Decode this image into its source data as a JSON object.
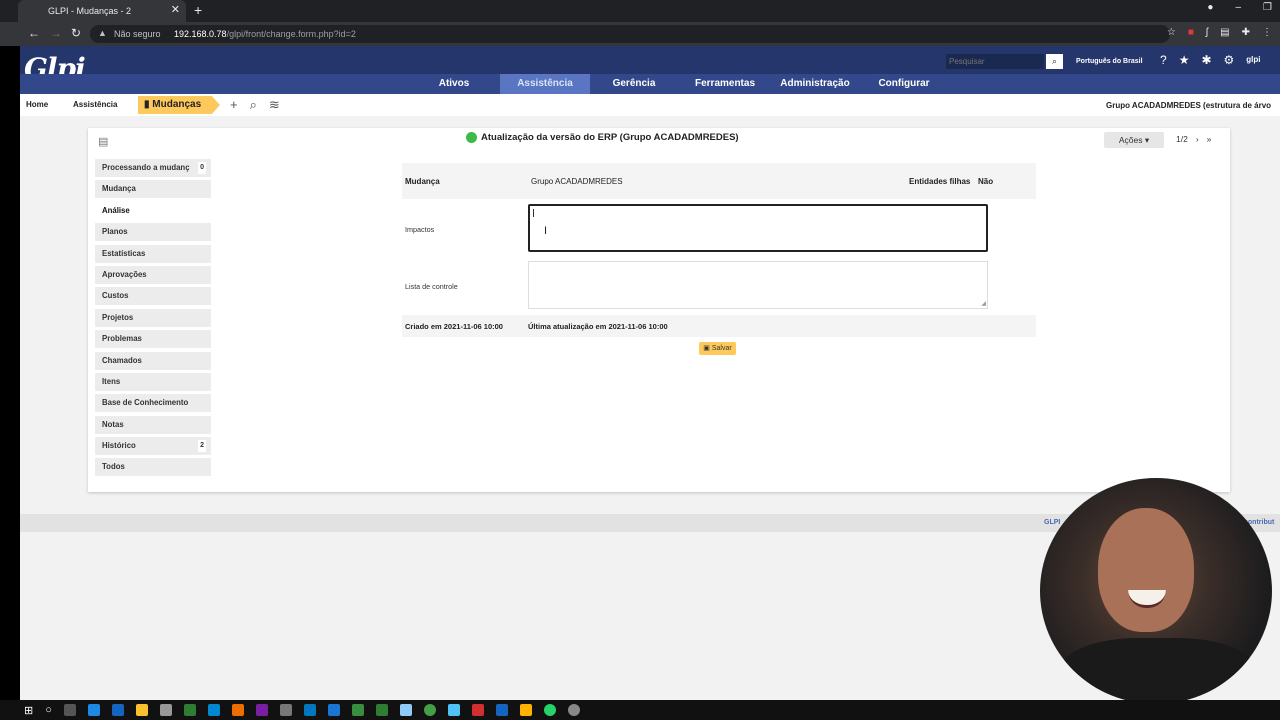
{
  "browser": {
    "tab_title": "GLPI - Mudanças - 2",
    "security_label": "Não seguro",
    "url_host": "192.168.0.78",
    "url_path": "/glpi/front/change.form.php?id=2"
  },
  "header": {
    "logo": "Glpi",
    "search_placeholder": "Pesquisar",
    "language": "Português do Brasil",
    "user": "glpi",
    "menu": [
      "Ativos",
      "Assistência",
      "Gerência",
      "Ferramentas",
      "Administração",
      "Configurar"
    ],
    "active_menu": "Assistência"
  },
  "breadcrumb": {
    "home": "Home",
    "section": "Assistência",
    "current": "Mudanças",
    "entity": "Grupo ACADADMREDES (estrutura de árvo"
  },
  "item": {
    "title": "Atualização da versão do ERP (Grupo ACADADMREDES)",
    "status_color": "#3dbb47",
    "actions_label": "Ações",
    "pager": "1/2"
  },
  "tabs": [
    {
      "label": "Processando a mudanç",
      "count": "0"
    },
    {
      "label": "Mudança",
      "count": ""
    },
    {
      "label": "Análise",
      "count": ""
    },
    {
      "label": "Planos",
      "count": ""
    },
    {
      "label": "Estatísticas",
      "count": ""
    },
    {
      "label": "Aprovações",
      "count": ""
    },
    {
      "label": "Custos",
      "count": ""
    },
    {
      "label": "Projetos",
      "count": ""
    },
    {
      "label": "Problemas",
      "count": ""
    },
    {
      "label": "Chamados",
      "count": ""
    },
    {
      "label": "Itens",
      "count": ""
    },
    {
      "label": "Base de Conhecimento",
      "count": ""
    },
    {
      "label": "Notas",
      "count": ""
    },
    {
      "label": "Histórico",
      "count": "2"
    },
    {
      "label": "Todos",
      "count": ""
    }
  ],
  "active_tab": "Análise",
  "form": {
    "head_label": "Mudança",
    "head_value": "Grupo ACADADMREDES",
    "child_label": "Entidades filhas",
    "child_value": "Não",
    "impacts_label": "Impactos",
    "impacts_value": "",
    "checklist_label": "Lista de controle",
    "checklist_value": "",
    "created": "Criado em 2021-11-06 10:00",
    "updated": "Última atualização em 2021-11-06 10:00",
    "save_label": "Salvar"
  },
  "footer": {
    "left": "GLPI",
    "right": "contribut"
  }
}
